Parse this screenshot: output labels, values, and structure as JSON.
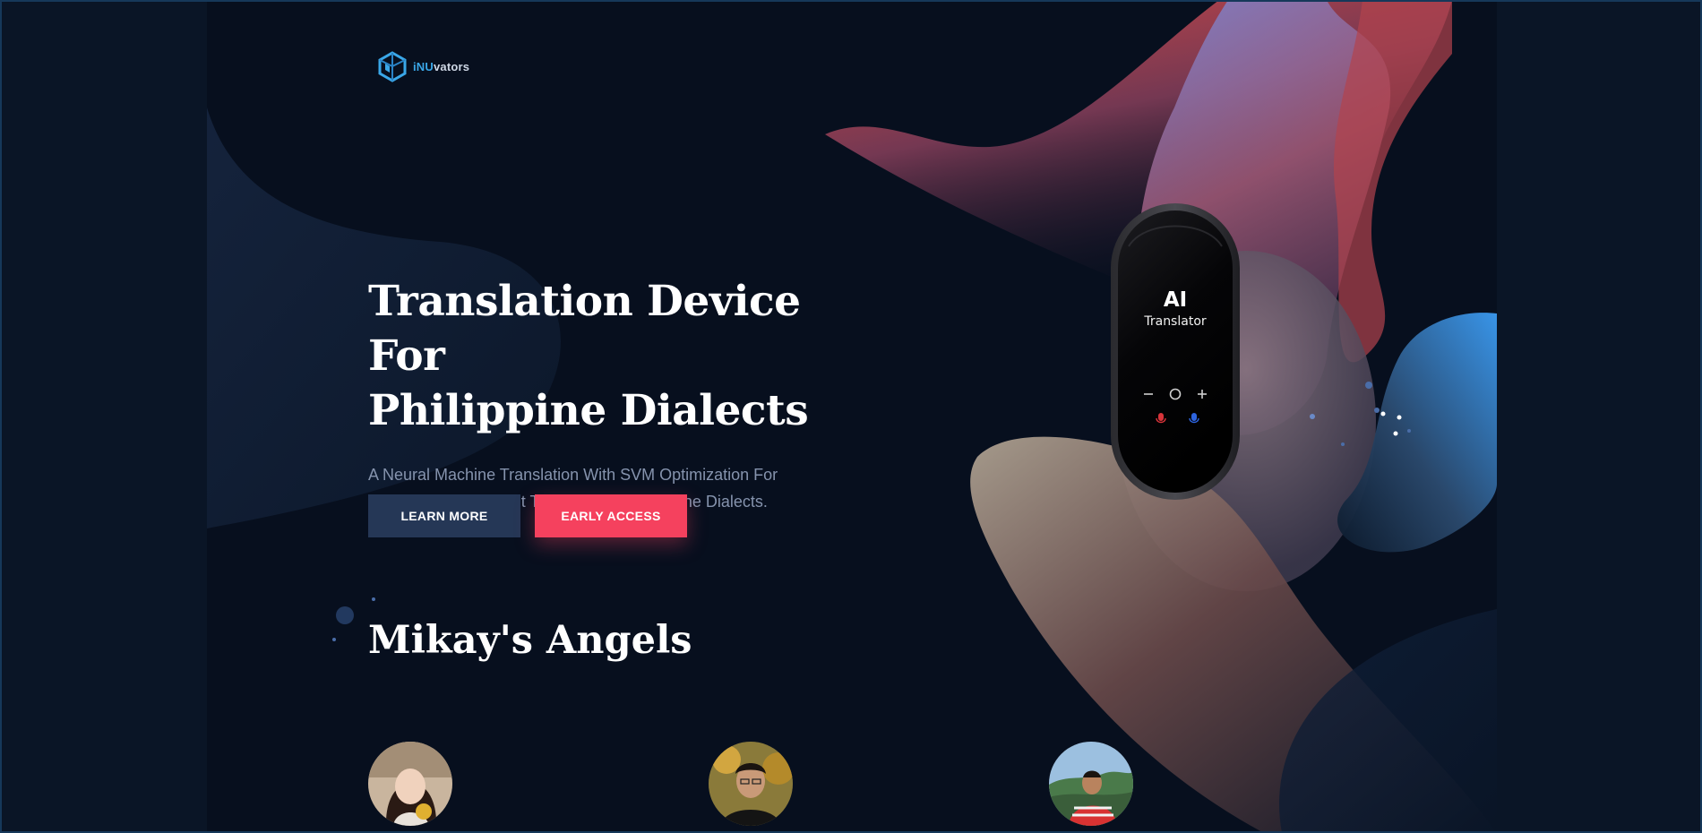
{
  "brand": {
    "logo_prefix": "iNU",
    "logo_suffix": "vators",
    "accent": "#3aa7e8"
  },
  "hero": {
    "title_line1": "Translation Device For",
    "title_line2": "Philippine Dialects",
    "subtitle_line1": "A Neural Machine Translation With SVM Optimization For",
    "subtitle_line2": "Accurate And Efficient Translation of Philippine Dialects."
  },
  "buttons": {
    "learn_more": "LEARN MORE",
    "early_access": "EARLY ACCESS",
    "learn_color": "#253756",
    "early_color": "#f5415e"
  },
  "device": {
    "label_ai": "AI",
    "label_sub": "Translator"
  },
  "team": {
    "title": "Mikay's Angels",
    "members": [
      {
        "avatar": "avatar-woman"
      },
      {
        "avatar": "avatar-man-glasses"
      },
      {
        "avatar": "avatar-man-red-shirt"
      }
    ]
  }
}
